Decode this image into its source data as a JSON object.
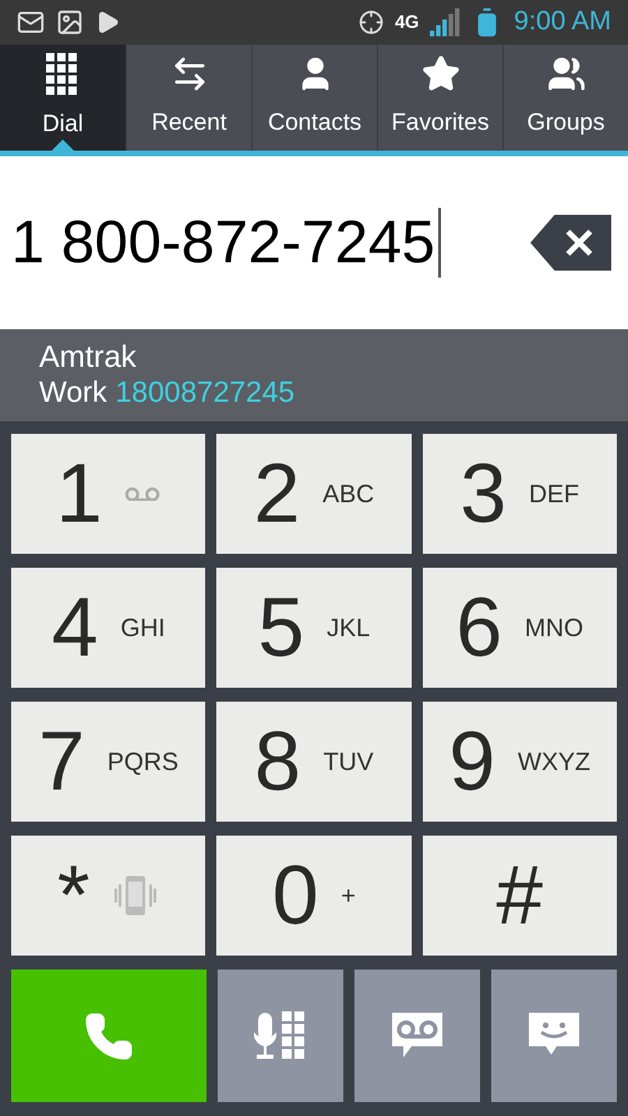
{
  "status_bar": {
    "time": "9:00 AM",
    "network": "4G"
  },
  "tabs": [
    {
      "label": "Dial",
      "kind": "dial",
      "selected": true
    },
    {
      "label": "Recent",
      "kind": "recent",
      "selected": false
    },
    {
      "label": "Contacts",
      "kind": "contacts",
      "selected": false
    },
    {
      "label": "Favorites",
      "kind": "favorites",
      "selected": false
    },
    {
      "label": "Groups",
      "kind": "groups",
      "selected": false
    }
  ],
  "dialed_number": "1 800-872-7245",
  "match": {
    "name": "Amtrak",
    "label": "Work",
    "number": "18008727245"
  },
  "keys": [
    {
      "digit": "1",
      "kind": "voicemail"
    },
    {
      "digit": "2",
      "kind": "letters",
      "letters": "ABC"
    },
    {
      "digit": "3",
      "kind": "letters",
      "letters": "DEF"
    },
    {
      "digit": "4",
      "kind": "letters",
      "letters": "GHI"
    },
    {
      "digit": "5",
      "kind": "letters",
      "letters": "JKL"
    },
    {
      "digit": "6",
      "kind": "letters",
      "letters": "MNO"
    },
    {
      "digit": "7",
      "kind": "letters",
      "letters": "PQRS"
    },
    {
      "digit": "8",
      "kind": "letters",
      "letters": "TUV"
    },
    {
      "digit": "9",
      "kind": "letters",
      "letters": "WXYZ"
    },
    {
      "digit": "*",
      "kind": "vibrate"
    },
    {
      "digit": "0",
      "kind": "letters",
      "letters": "+"
    },
    {
      "digit": "#",
      "kind": "plain"
    }
  ],
  "actions": [
    {
      "kind": "call"
    },
    {
      "kind": "voice-dial"
    },
    {
      "kind": "voicemail"
    },
    {
      "kind": "message"
    }
  ]
}
